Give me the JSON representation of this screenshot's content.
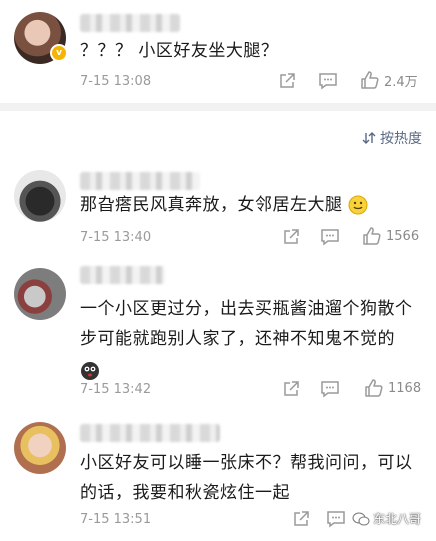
{
  "comments": [
    {
      "text": "？？？ 小区好友坐大腿？",
      "time": "7-15 13:08",
      "likes": "2.4万",
      "verified_badge": "v"
    },
    {
      "text": "那旮瘩民风真奔放，女邻居左大腿",
      "time": "7-15 13:40",
      "likes": "1566"
    },
    {
      "text_line1": "一个小区更过分，出去买瓶酱油遛个狗散个",
      "text_line2": "步可能就跑别人家了，还神不知鬼不觉的",
      "time": "7-15 13:42",
      "likes": "1168"
    },
    {
      "text_line1": "小区好友可以睡一张床不？帮我问问，可以",
      "text_line2": "的话，我要和秋瓷炫住一起",
      "time": "7-15 13:51"
    }
  ],
  "sort": {
    "label": "按热度"
  },
  "watermark": {
    "text": "东北八哥"
  },
  "colors": {
    "accent": "#5a6a86",
    "meta": "#9a9a9a",
    "separator": "#f2f2f2"
  }
}
